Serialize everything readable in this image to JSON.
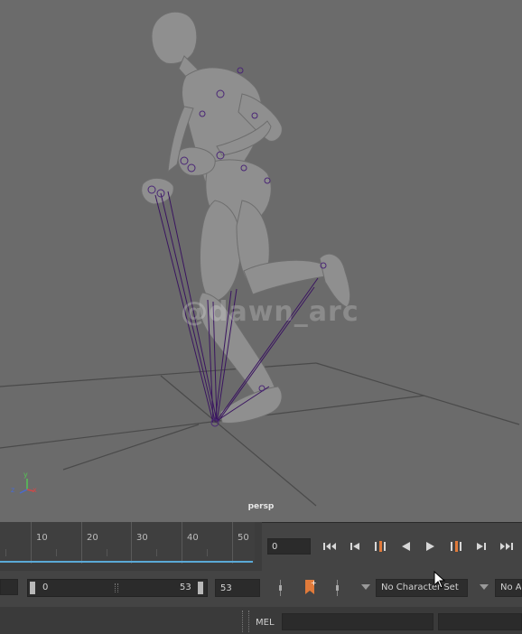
{
  "viewport": {
    "camera_label": "persp",
    "watermark": "@dawn_arc",
    "background": "#6b6b6b",
    "rig_color": "#3a1560",
    "axis_labels": {
      "x": "x",
      "y": "y",
      "z": "z"
    }
  },
  "timeline": {
    "ticks": [
      "10",
      "20",
      "30",
      "40",
      "50"
    ],
    "current_time": "0",
    "range_color": "#5aa9d6"
  },
  "range_slider": {
    "start": "0",
    "end": "53",
    "playback_end": "53"
  },
  "playback_icons": [
    "go-to-start-icon",
    "step-back-frame-icon",
    "step-back-key-icon",
    "play-backward-icon",
    "play-forward-icon",
    "step-forward-key-icon",
    "step-forward-frame-icon",
    "go-to-end-icon"
  ],
  "character_set": {
    "label": "No Character Set"
  },
  "anim_layer": {
    "label": "No A"
  },
  "command_line": {
    "label": "MEL",
    "value": ""
  }
}
